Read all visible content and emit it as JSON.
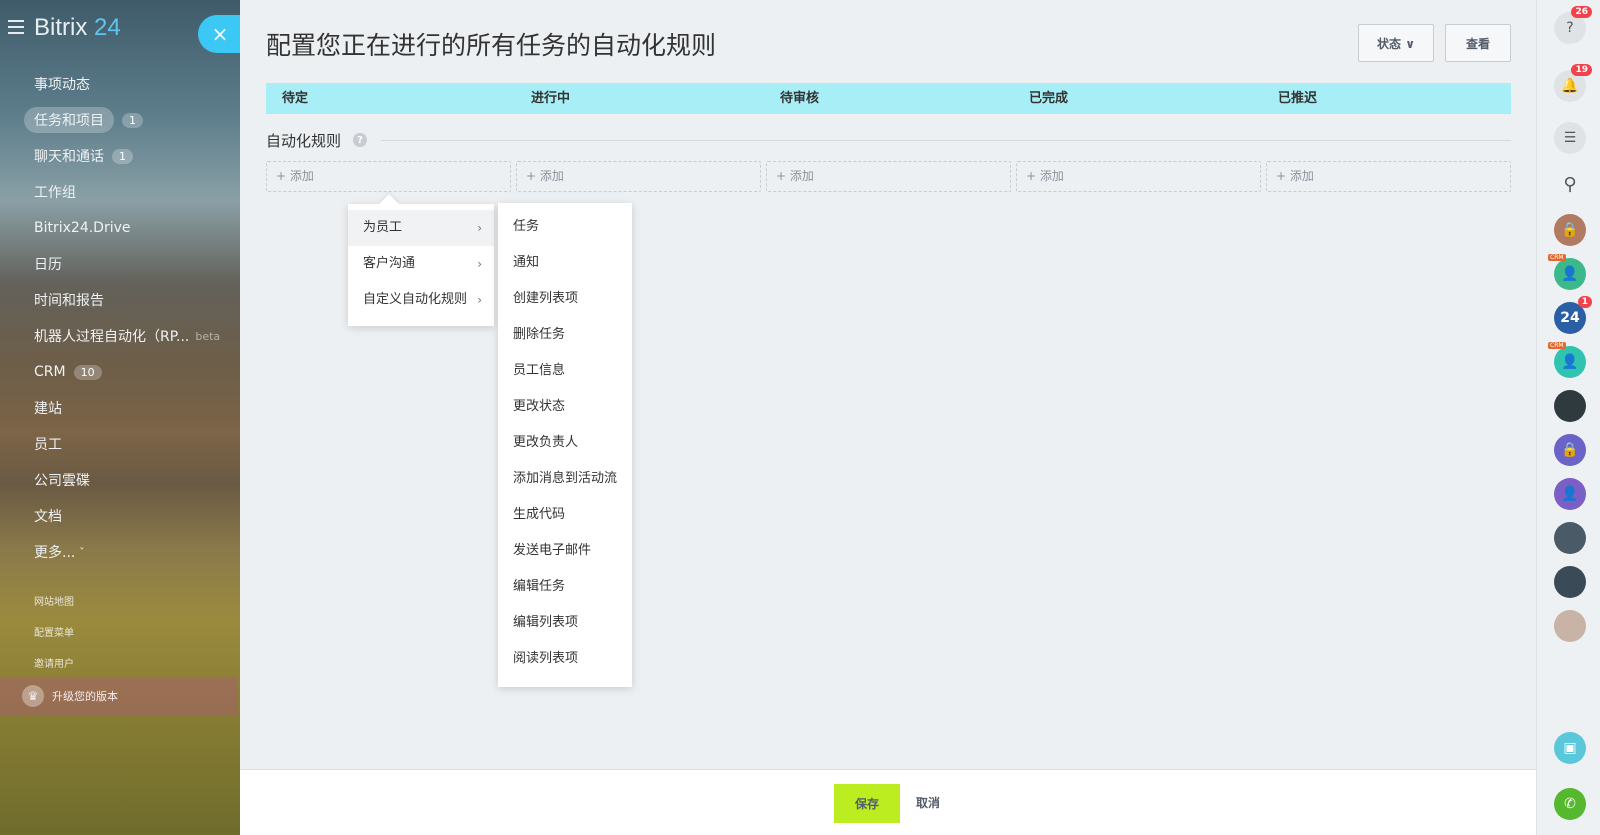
{
  "sidebar": {
    "logo_text": "Bitrix",
    "logo_num": "24",
    "close": "×",
    "items": [
      {
        "label": "事项动态",
        "count": ""
      },
      {
        "label": "任务和项目",
        "count": "1"
      },
      {
        "label": "聊天和通话",
        "count": "1"
      },
      {
        "label": "工作组",
        "count": ""
      },
      {
        "label": "Bitrix24.Drive",
        "count": ""
      },
      {
        "label": "日历",
        "count": ""
      },
      {
        "label": "时间和报告",
        "count": ""
      },
      {
        "label": "机器人过程自动化（RP...",
        "beta": "beta"
      },
      {
        "label": "CRM",
        "count": "10"
      },
      {
        "label": "建站",
        "count": ""
      },
      {
        "label": "员工",
        "count": ""
      },
      {
        "label": "公司雲碟",
        "count": ""
      },
      {
        "label": "文档",
        "count": ""
      },
      {
        "label": "更多...",
        "chev": "˅"
      }
    ],
    "sitemap": "网站地图",
    "config_menu": "配置菜单",
    "invite": "邀请用户",
    "upgrade": "升级您的版本"
  },
  "main": {
    "title": "配置您正在进行的所有任务的自动化规则",
    "status_btn": "状态 ∨",
    "view_btn": "查看",
    "stages": [
      "待定",
      "进行中",
      "待审核",
      "已完成",
      "已推迟"
    ],
    "rules_title": "自动化规则",
    "help": "?",
    "add_label": "+ 添加"
  },
  "menu1": [
    {
      "label": "为员工",
      "chev": "›"
    },
    {
      "label": "客户沟通",
      "chev": "›"
    },
    {
      "label": "自定义自动化规则",
      "chev": "›"
    }
  ],
  "menu2": [
    "任务",
    "通知",
    "创建列表项",
    "删除任务",
    "员工信息",
    "更改状态",
    "更改负责人",
    "添加消息到活动流",
    "生成代码",
    "发送电子邮件",
    "编辑任务",
    "编辑列表项",
    "阅读列表项"
  ],
  "footer": {
    "save": "保存",
    "cancel": "取消"
  },
  "rightbar": {
    "help_badge": "26",
    "bell_badge": "19",
    "b24_badge": "1",
    "b24_text": "24",
    "crm_tag": "CRM"
  },
  "colors": {
    "accent": "#3bc8f5",
    "stage_bar": "#a8eef7",
    "save": "#bbed21"
  }
}
